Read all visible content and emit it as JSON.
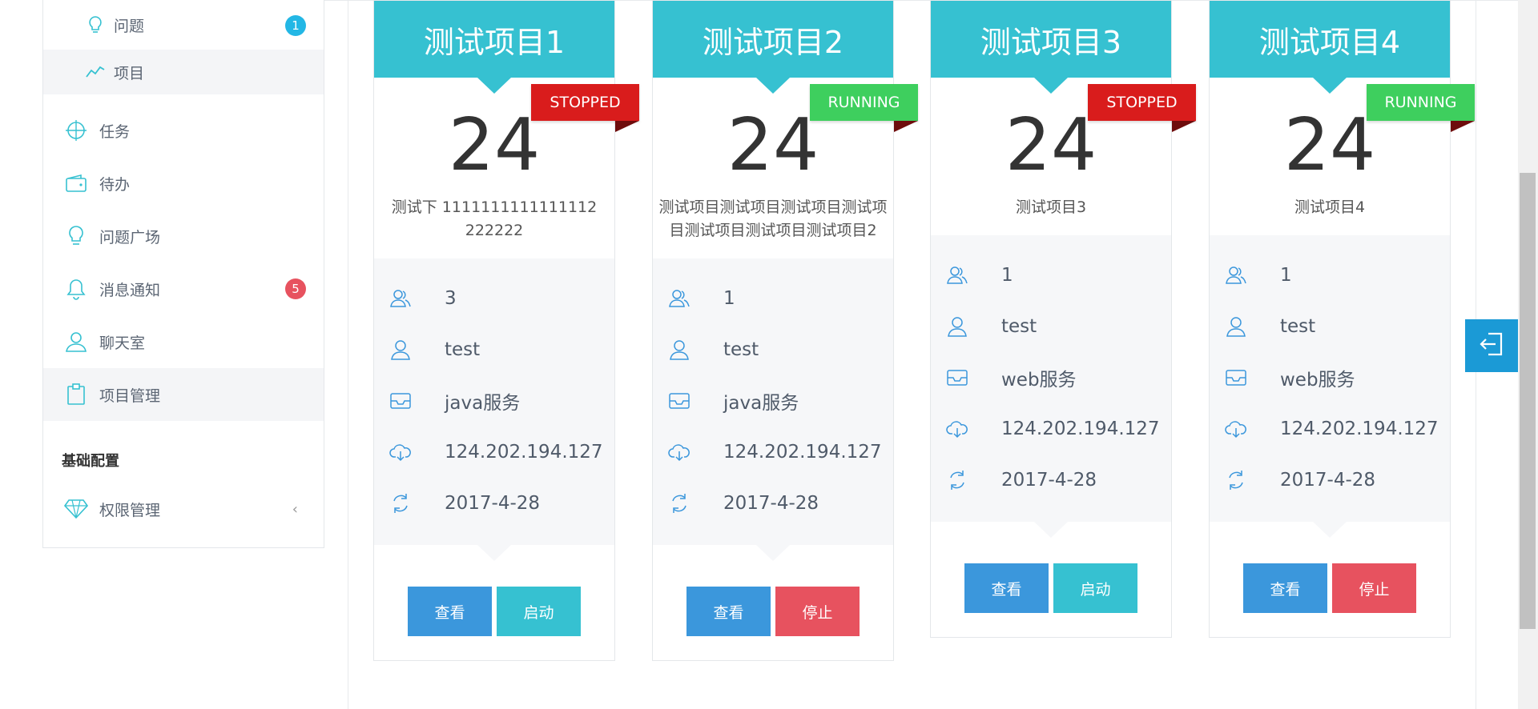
{
  "sidebar": {
    "sub_items": [
      {
        "label": "问题",
        "badge": "1",
        "badge_color": "#23b7e5",
        "icon": "bulb-icon"
      },
      {
        "label": "项目",
        "icon": "trend-icon",
        "active": true
      }
    ],
    "items": [
      {
        "label": "任务",
        "icon": "crosshair-icon"
      },
      {
        "label": "待办",
        "icon": "wallet-icon"
      },
      {
        "label": "问题广场",
        "icon": "bulb-icon"
      },
      {
        "label": "消息通知",
        "icon": "bell-icon",
        "badge": "5",
        "badge_color": "#e7525f"
      },
      {
        "label": "聊天室",
        "icon": "user-icon"
      },
      {
        "label": "项目管理",
        "icon": "clipboard-icon",
        "active": true
      }
    ],
    "section_title": "基础配置",
    "config_items": [
      {
        "label": "权限管理",
        "icon": "diamond-icon",
        "chevron": "‹"
      }
    ]
  },
  "colors": {
    "accent": "#36c1d1",
    "view_button": "#3b97dc",
    "start_button": "#36c1d1",
    "stop_button": "#e7525f",
    "stopped_ribbon": "#d91c1c",
    "running_ribbon": "#3ecf5e"
  },
  "cards": [
    {
      "title": "测试项目1",
      "status": "STOPPED",
      "count": "24",
      "description": "测试下 1111111111111112222222",
      "members": "3",
      "owner": "test",
      "service": "java服务",
      "ip": "124.202.194.127",
      "date": "2017-4-28",
      "view_label": "查看",
      "action_label": "启动"
    },
    {
      "title": "测试项目2",
      "status": "RUNNING",
      "count": "24",
      "description": "测试项目测试项目测试项目测试项目测试项目测试项目测试项目2",
      "members": "1",
      "owner": "test",
      "service": "java服务",
      "ip": "124.202.194.127",
      "date": "2017-4-28",
      "view_label": "查看",
      "action_label": "停止"
    },
    {
      "title": "测试项目3",
      "status": "STOPPED",
      "count": "24",
      "description": "测试项目3",
      "members": "1",
      "owner": "test",
      "service": "web服务",
      "ip": "124.202.194.127",
      "date": "2017-4-28",
      "view_label": "查看",
      "action_label": "启动"
    },
    {
      "title": "测试项目4",
      "status": "RUNNING",
      "count": "24",
      "description": "测试项目4",
      "members": "1",
      "owner": "test",
      "service": "web服务",
      "ip": "124.202.194.127",
      "date": "2017-4-28",
      "view_label": "查看",
      "action_label": "停止"
    }
  ],
  "logout_icon": "logout-icon"
}
